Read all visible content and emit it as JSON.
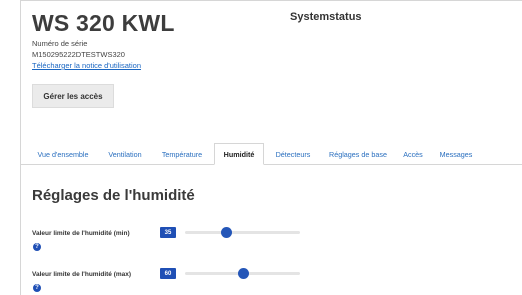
{
  "header": {
    "device_title": "WS 320 KWL",
    "status_title": "Systemstatus",
    "serial_label": "Numéro de série",
    "serial_value": "M150295222DTESTWS320",
    "manual_link": "Télécharger la notice d'utilisation",
    "access_button": "Gérer les accès"
  },
  "tabs": [
    {
      "label": "Vue d'ensemble",
      "active": false
    },
    {
      "label": "Ventilation",
      "active": false
    },
    {
      "label": "Température",
      "active": false
    },
    {
      "label": "Humidité",
      "active": true
    },
    {
      "label": "Détecteurs",
      "active": false
    },
    {
      "label": "Réglages de base",
      "active": false
    },
    {
      "label": "Accès",
      "active": false
    },
    {
      "label": "Messages",
      "active": false
    }
  ],
  "section": {
    "title": "Réglages de l'humidité"
  },
  "settings": {
    "min": {
      "label": "Valeur limite de l'humidité (min)",
      "value": "35",
      "fraction": 0.36
    },
    "max": {
      "label": "Valeur limite de l'humidité (max)",
      "value": "60",
      "fraction": 0.5
    }
  },
  "icons": {
    "help": "question-circle-icon"
  },
  "colors": {
    "accent": "#1f4fb5",
    "link": "#2a6fbf"
  }
}
